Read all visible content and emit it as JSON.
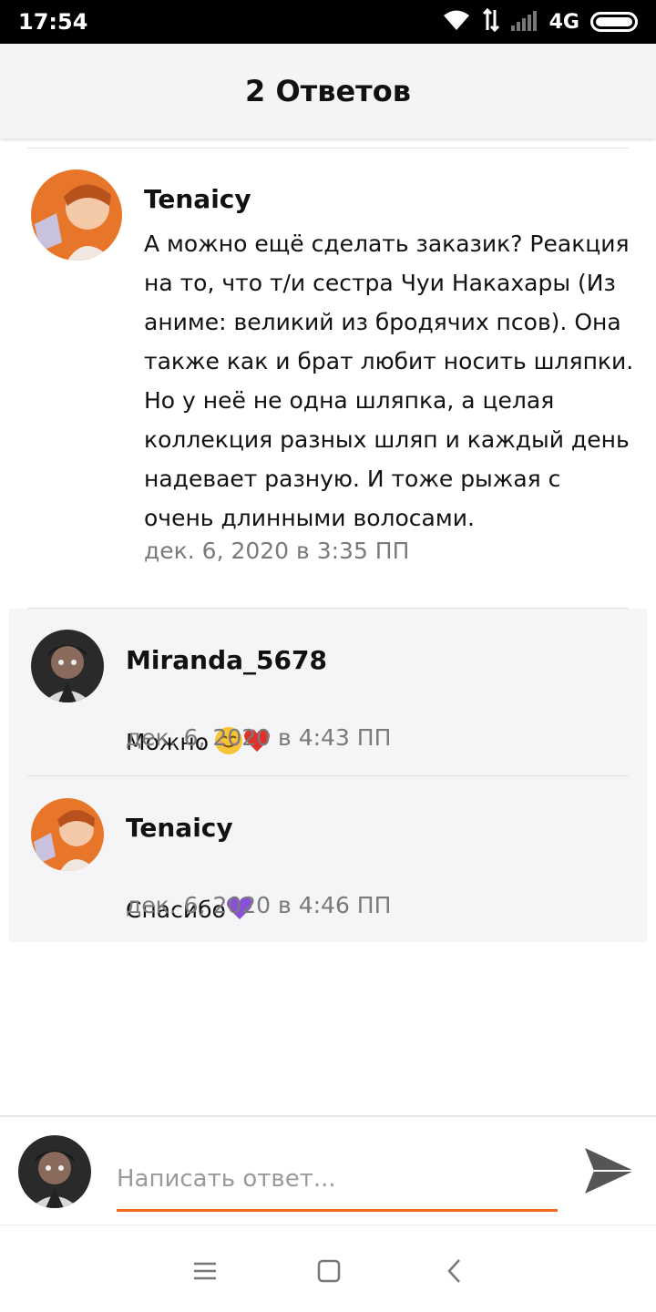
{
  "status_bar": {
    "time": "17:54",
    "network": "4G",
    "icons": [
      "wifi-icon",
      "data-transfer-icon",
      "signal-icon",
      "battery-icon"
    ]
  },
  "header": {
    "title": "2 Ответов"
  },
  "main_comment": {
    "author": "Tenaicy",
    "text": "А можно ещё сделать заказик? Реакция\nна то, что т/и сестра Чуи Накахары (Из\nаниме: великий из бродячих псов). Она\nтакже как и брат любит носить шляпки.\nНо у неё не одна шляпка, а целая\nколлекция разных шляп и каждый день\nнадевает  разную. И тоже рыжая с\nочень длинными волосами.",
    "timestamp": "дек. 6, 2020 в 3:35 ПП"
  },
  "replies": [
    {
      "author": "Miranda_5678",
      "text": "Можно",
      "emojis": [
        "smiling-face-icon",
        "red-heart-icon"
      ],
      "timestamp": "дек. 6, 2020 в 4:43 ПП"
    },
    {
      "author": "Tenaicy",
      "text": "Спасибо",
      "emojis": [
        "purple-heart-icon"
      ],
      "timestamp": "дек. 6, 2020 в 4:46 ПП"
    }
  ],
  "reply_bar": {
    "placeholder": "Написать ответ..."
  },
  "nav_bar": {
    "icons": [
      "menu-icon",
      "home-square-icon",
      "back-icon"
    ]
  },
  "colors": {
    "accent": "#f06a1f",
    "reply_bg": "#f5f4f7",
    "timestamp": "#7a7a7a"
  }
}
